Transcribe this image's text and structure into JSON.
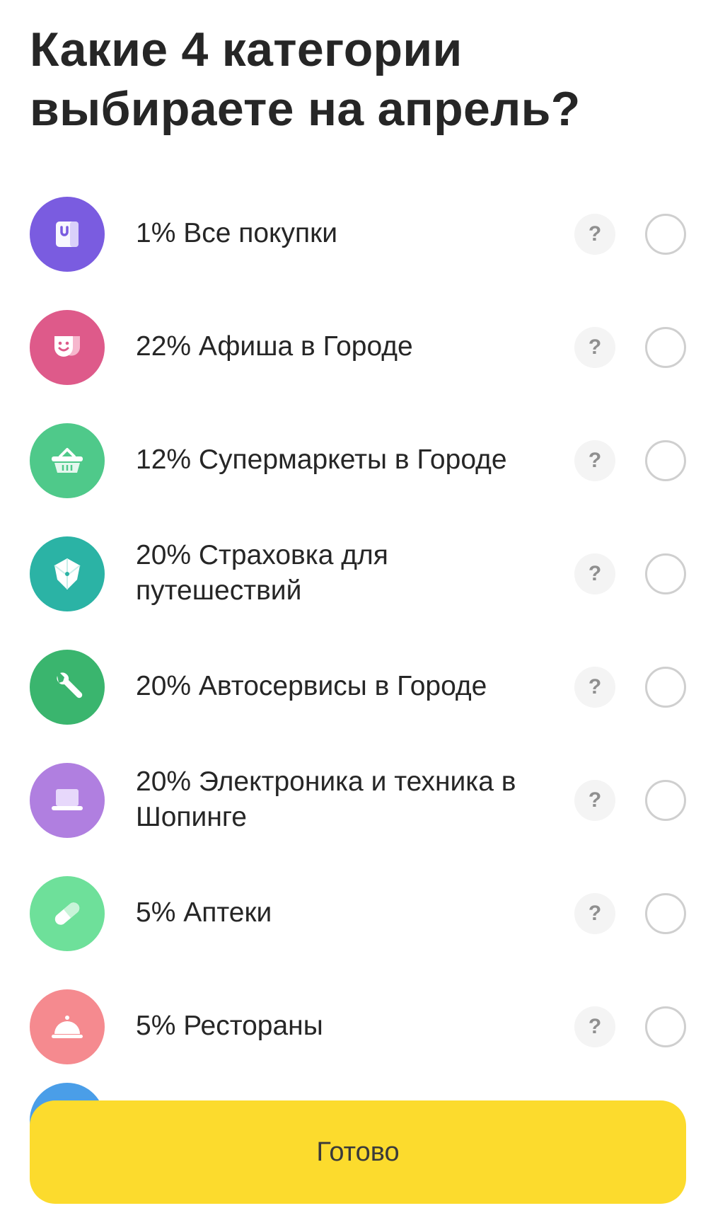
{
  "title": "Какие 4 категории выбираете на апрель?",
  "help_glyph": "?",
  "categories": [
    {
      "label": "1% Все покупки",
      "icon": "shopping-bag-icon",
      "color": "#7a5ce0"
    },
    {
      "label": "22% Афиша в Городе",
      "icon": "theater-masks-icon",
      "color": "#de5a8a"
    },
    {
      "label": "12% Супермаркеты в Городе",
      "icon": "basket-icon",
      "color": "#4fc98a"
    },
    {
      "label": "20% Страховка для путешествий",
      "icon": "umbrella-icon",
      "color": "#2bb3a5"
    },
    {
      "label": "20% Автосервисы в Городе",
      "icon": "wrench-icon",
      "color": "#3ab56e"
    },
    {
      "label": "20% Электроника и техника в Шопинге",
      "icon": "laptop-icon",
      "color": "#b07fe0"
    },
    {
      "label": "5% Аптеки",
      "icon": "pill-icon",
      "color": "#6ee09a"
    },
    {
      "label": "5% Рестораны",
      "icon": "cloche-icon",
      "color": "#f58a8f"
    }
  ],
  "partial_icon_color": "#4a9ee8",
  "done_button": {
    "label": "Готово",
    "color": "#fcdb2d"
  }
}
